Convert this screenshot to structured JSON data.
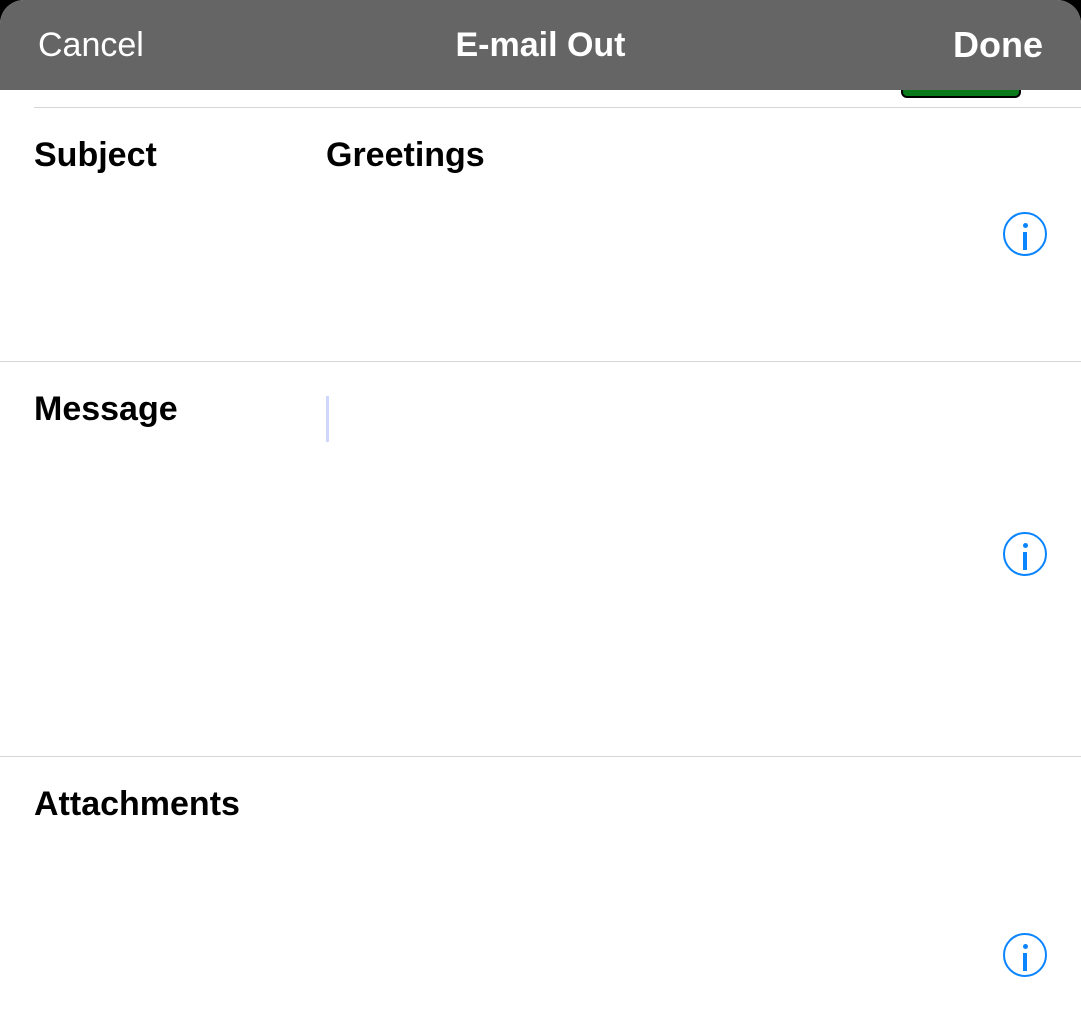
{
  "header": {
    "cancel": "Cancel",
    "title": "E-mail Out",
    "done": "Done"
  },
  "sections": {
    "subject": {
      "label": "Subject",
      "value": "Greetings"
    },
    "message": {
      "label": "Message",
      "value": ""
    },
    "attachments": {
      "label": "Attachments",
      "value": ""
    }
  },
  "icons": {
    "info": "info-icon"
  },
  "colors": {
    "accent": "#0a84ff",
    "headerBg": "#656565"
  }
}
